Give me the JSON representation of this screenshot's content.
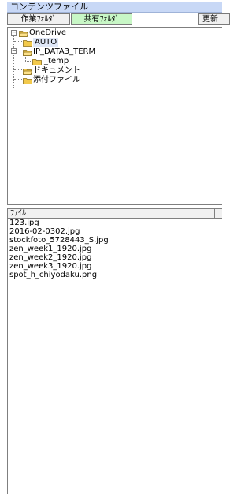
{
  "panel": {
    "title": "コンテンツファイル"
  },
  "tabs": [
    {
      "label": "作業ﾌｫﾙﾀﾞ"
    },
    {
      "label": "共有ﾌｫﾙﾀﾞ"
    },
    {
      "label": "更新"
    }
  ],
  "tree": {
    "items": [
      {
        "label": "OneDrive"
      },
      {
        "label": "AUTO"
      },
      {
        "label": "IP_DATA3_TERM"
      },
      {
        "label": "_temp"
      },
      {
        "label": "ドキュメント"
      },
      {
        "label": "添付ファイル"
      }
    ]
  },
  "files": {
    "header": "ﾌｧｲﾙ",
    "items": [
      "123.jpg",
      "2016-02-0302.jpg",
      "stockfoto_5728443_S.jpg",
      "zen_week1_1920.jpg",
      "zen_week2_1920.jpg",
      "zen_week3_1920.jpg",
      "spot_h_chiyodaku.png"
    ]
  },
  "colors": {
    "title_bg": "#c8d8f6",
    "active_tab_bg": "#c8f7c6",
    "folder": "#f2c94c"
  },
  "icons": {
    "folder": "folder-icon",
    "folder_open": "folder-open-icon",
    "collapse": "minus-box-icon"
  }
}
